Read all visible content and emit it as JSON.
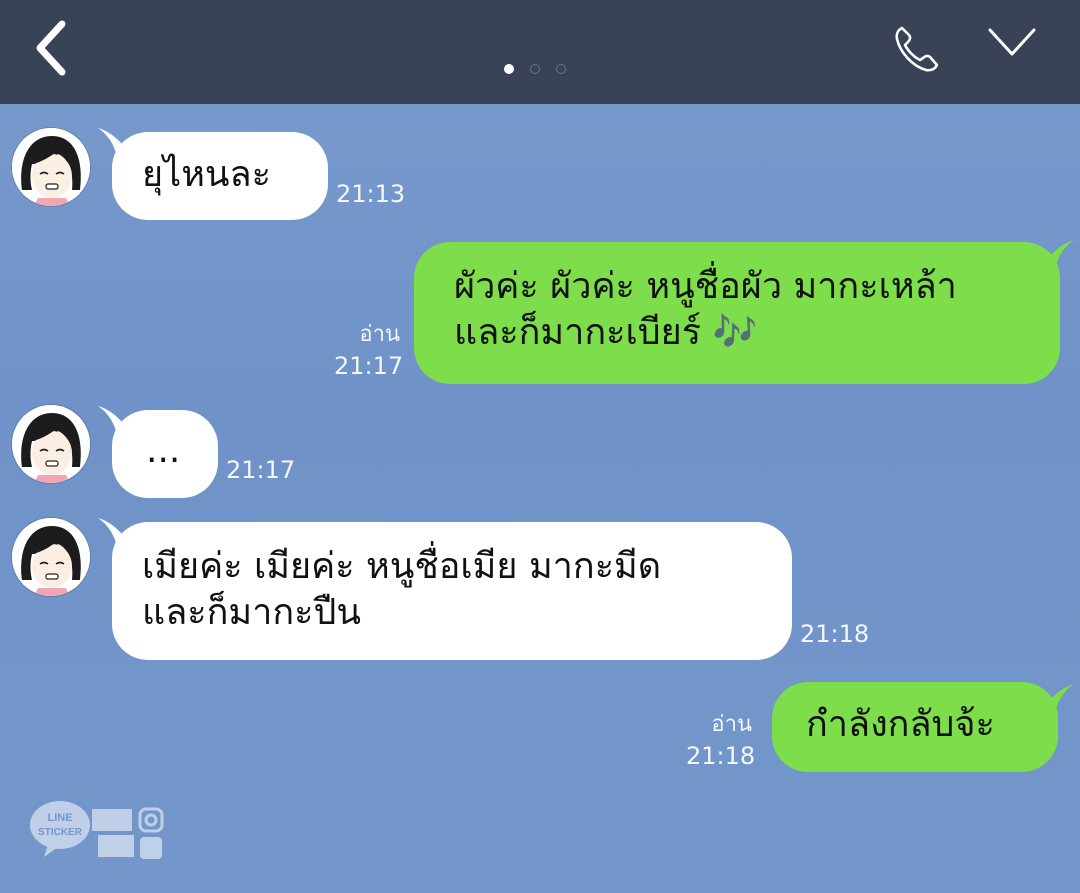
{
  "header": {
    "back_icon": "chevron-left-icon",
    "call_icon": "phone-icon",
    "menu_icon": "chevron-down-icon",
    "page_dots": {
      "count": 3,
      "active": 0
    }
  },
  "messages": [
    {
      "side": "in",
      "text": "ยุไหนละ",
      "time": "21:13"
    },
    {
      "side": "out",
      "text": "ผัวค่ะ ผัวค่ะ หนูชื่อผัว มากะเหล้า\nและก็มากะเบียร์ 🎶",
      "read": "อ่าน",
      "time": "21:17"
    },
    {
      "side": "in",
      "text": "...",
      "time": "21:17"
    },
    {
      "side": "in",
      "text": "เมียค่ะ เมียค่ะ หนูชื่อเมีย มากะมีด\nและก็มากะปืน",
      "time": "21:18"
    },
    {
      "side": "out",
      "text": "กำลังกลับจ้ะ",
      "read": "อ่าน",
      "time": "21:18"
    }
  ],
  "watermark": {
    "line1": "LINE",
    "line2": "STICKER"
  },
  "colors": {
    "header": "#3a4257",
    "background": "#7497cb",
    "incoming_bubble": "#ffffff",
    "outgoing_bubble": "#7ddd4a"
  }
}
